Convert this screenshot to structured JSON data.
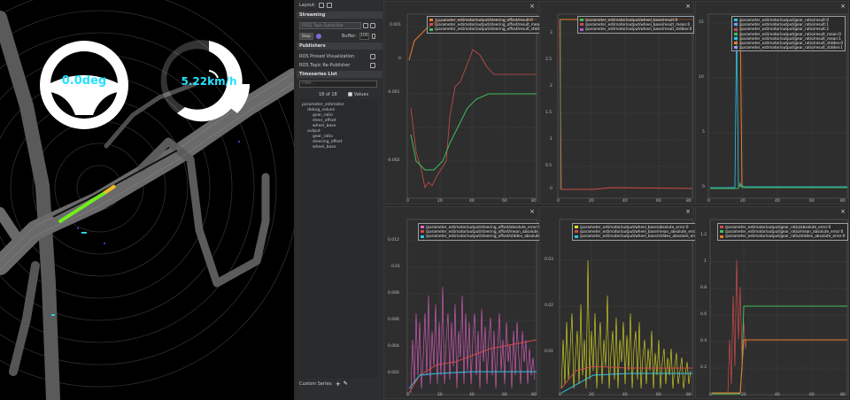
{
  "viewer": {
    "steering_value": "0.0deg",
    "speed_value": "5.22km/h"
  },
  "panel": {
    "layout_label": "Layout:",
    "streaming_header": "Streaming",
    "source_placeholder": "ROS2 Topic Subscriber",
    "stop_label": "Stop",
    "buffer_label": "Buffer:",
    "buffer_value": "100",
    "publishers_header": "Publishers",
    "publishers": [
      "ROS Prosed Visualization",
      "ROS Topic Re-Publisher"
    ],
    "timeseries_header": "Timeseries List",
    "filter_placeholder": "Filter...",
    "count_text": "18 of 18",
    "values_label": "Values",
    "tree": [
      "parameter_estimator",
      "debug_values",
      "gear_ratio",
      "steer_offset",
      "wheel_base",
      "output",
      "gear_ratio",
      "steering_offset",
      "wheel_base"
    ],
    "custom_series_label": "Custom Series:"
  },
  "plots": [
    {
      "legend": [
        "/parameter_estimator/output/steering_offset/result:0",
        "/parameter_estimator/output/steering_offset/result_mean:0",
        "/parameter_estimator/output/steering_offset/result_stddev:0"
      ],
      "colors": [
        "#f07a2a",
        "#d04b4b",
        "#3fbf5c"
      ],
      "yticks": [
        "0.001",
        "0",
        "-0.001",
        "-0.002"
      ],
      "xticks": [
        "0",
        "20",
        "40",
        "60",
        "80"
      ]
    },
    {
      "legend": [
        "/parameter_estimator/output/wheel_base/result:0",
        "/parameter_estimator/output/wheel_base/result_mean:0",
        "/parameter_estimator/output/wheel_base/result_stddev:0"
      ],
      "colors": [
        "#3fbf5c",
        "#d04b4b",
        "#b060d0"
      ],
      "yticks": [
        "3",
        "2.5",
        "2",
        "1.5",
        "1",
        "0.5",
        "0"
      ],
      "xticks": [
        "0",
        "20",
        "40",
        "60",
        "80"
      ]
    },
    {
      "legend": [
        "/parameter_estimator/output/gear_ratio/result:0",
        "/parameter_estimator/output/gear_ratio/result:1",
        "/parameter_estimator/output/gear_ratio/result:2",
        "/parameter_estimator/output/gear_ratio/result_mean:0",
        "/parameter_estimator/output/gear_ratio/result_mean:1",
        "/parameter_estimator/output/gear_ratio/result_stddev:0",
        "/parameter_estimator/output/gear_ratio/result_stddev:1"
      ],
      "colors": [
        "#2ec4e8",
        "#6fa0ff",
        "#d04b4b",
        "#3fbf5c",
        "#2ec4e8",
        "#f07a2a",
        "#9b9bff"
      ],
      "yticks": [
        "15",
        "10",
        "5",
        "0"
      ],
      "xticks": [
        "0",
        "20",
        "40",
        "60",
        "80"
      ]
    },
    {
      "legend": [
        "/parameter_estimator/output/steering_offset/absolute_error:0",
        "/parameter_estimator/output/steering_offset/mean_absolute_error:0",
        "/parameter_estimator/output/steering_offset/stddev_absolute_error:0"
      ],
      "colors": [
        "#e060c8",
        "#d04b4b",
        "#2ec4e8"
      ],
      "yticks": [
        "0.012",
        "0.01",
        "0.008",
        "0.006",
        "0.004",
        "0.002"
      ],
      "xticks": [
        "0",
        "20",
        "40",
        "60",
        "80"
      ]
    },
    {
      "legend": [
        "/parameter_estimator/output/wheel_base/absolute_error:0",
        "/parameter_estimator/output/wheel_base/mean_absolute_error:0",
        "/parameter_estimator/output/wheel_base/stddev_absolute_error:0"
      ],
      "colors": [
        "#e0e020",
        "#d04b4b",
        "#2ec4e8"
      ],
      "yticks": [
        "0.03",
        "0.02",
        "0.01"
      ],
      "xticks": [
        "0",
        "20",
        "40",
        "60",
        "80"
      ]
    },
    {
      "legend": [
        "/parameter_estimator/output/gear_ratio/absolute_error:0",
        "/parameter_estimator/output/gear_ratio/mean_absolute_error:0",
        "/parameter_estimator/output/gear_ratio/stddev_absolute_error:0"
      ],
      "colors": [
        "#d04b4b",
        "#3fbf5c",
        "#f07a2a"
      ],
      "yticks": [
        "1.2",
        "1",
        "0.8",
        "0.6",
        "0.4",
        "0.2"
      ],
      "xticks": [
        "0",
        "20",
        "40",
        "60",
        "80"
      ]
    }
  ]
}
